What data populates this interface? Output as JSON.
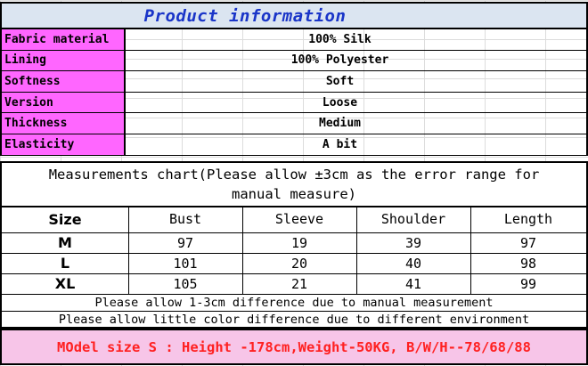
{
  "title": "Product information",
  "info_rows": [
    {
      "label": "Fabric material",
      "value": "100% Silk"
    },
    {
      "label": "Lining",
      "value": "100% Polyester"
    },
    {
      "label": "Softness",
      "value": "Soft"
    },
    {
      "label": "Version",
      "value": "Loose"
    },
    {
      "label": "Thickness",
      "value": "Medium"
    },
    {
      "label": "Elasticity",
      "value": "A bit"
    }
  ],
  "measurements": {
    "heading_line1": "Measurements chart(Please allow ±3cm as the error range for",
    "heading_line2": "manual measure)",
    "columns": [
      "Size",
      "Bust",
      "Sleeve",
      "Shoulder",
      "Length"
    ],
    "rows": [
      [
        "M",
        "97",
        "19",
        "39",
        "97"
      ],
      [
        "L",
        "101",
        "20",
        "40",
        "98"
      ],
      [
        "XL",
        "105",
        "21",
        "41",
        "99"
      ]
    ],
    "note1": "Please allow 1-3cm difference due to manual measurement",
    "note2": "Please allow little color difference due to different environment"
  },
  "model_size": "MOdel size  S : Height -178cm,Weight-50KG, B/W/H--78/68/88",
  "colors": {
    "title_bg": "#dbe5f1",
    "title_text": "#1a35c8",
    "label_bg": "#ff66ff",
    "model_bg": "#f7c5e8",
    "model_text": "#ff2020"
  }
}
